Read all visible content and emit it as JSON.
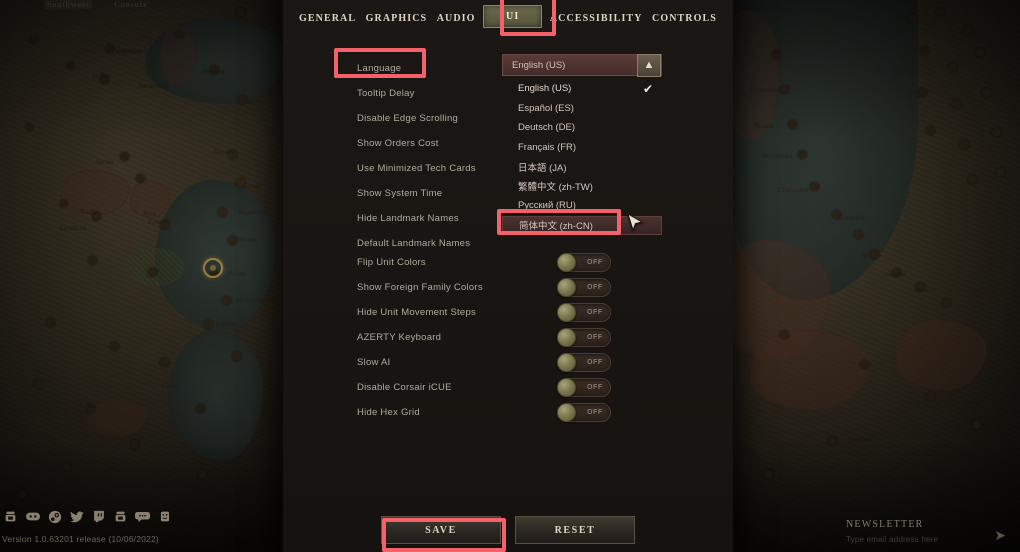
{
  "game": {
    "map_hud": [
      "Southwest",
      "Consuls"
    ],
    "version": "Version 1.0.63201 release (10/06/2022)",
    "social_icons": [
      "gog-icon",
      "discord-icon",
      "steam-icon",
      "twitter-icon",
      "twitch-icon",
      "gog-alt-icon",
      "forum-icon",
      "reddit-icon"
    ],
    "newsletter": {
      "title": "Newsletter",
      "subtitle": "Type email address here",
      "send_icon": "send-icon"
    }
  },
  "settings": {
    "tabs": [
      {
        "label": "General",
        "active": false
      },
      {
        "label": "Graphics",
        "active": false
      },
      {
        "label": "Audio",
        "active": false
      },
      {
        "label": "UI",
        "active": true
      },
      {
        "label": "Accessibility",
        "active": false
      },
      {
        "label": "Controls",
        "active": false
      }
    ],
    "rows": [
      {
        "label": "Language",
        "control": "dropdown"
      },
      {
        "label": "Tooltip Delay",
        "control": "none"
      },
      {
        "label": "Disable Edge Scrolling",
        "control": "none"
      },
      {
        "label": "Show Orders Cost",
        "control": "none"
      },
      {
        "label": "Use Minimized Tech Cards",
        "control": "none"
      },
      {
        "label": "Show System Time",
        "control": "none"
      },
      {
        "label": "Hide Landmark Names",
        "control": "none"
      },
      {
        "label": "Default Landmark Names",
        "control": "none"
      },
      {
        "label": "Flip Unit Colors",
        "control": "toggle",
        "state": "OFF"
      },
      {
        "label": "Show Foreign Family Colors",
        "control": "toggle",
        "state": "OFF"
      },
      {
        "label": "Hide Unit Movement Steps",
        "control": "toggle",
        "state": "OFF"
      },
      {
        "label": "AZERTY Keyboard",
        "control": "toggle",
        "state": "OFF"
      },
      {
        "label": "Slow AI",
        "control": "toggle",
        "state": "OFF"
      },
      {
        "label": "Disable Corsair iCUE",
        "control": "toggle",
        "state": "OFF"
      },
      {
        "label": "Hide Hex Grid",
        "control": "toggle",
        "state": "OFF"
      }
    ],
    "language_dropdown": {
      "selected": "English (US)",
      "expanded": true,
      "collapse_icon": "chevron-up-icon",
      "options": [
        {
          "label": "English (US)",
          "checked": true,
          "highlighted": false
        },
        {
          "label": "Español (ES)",
          "checked": false,
          "highlighted": false
        },
        {
          "label": "Deutsch (DE)",
          "checked": false,
          "highlighted": false
        },
        {
          "label": "Français (FR)",
          "checked": false,
          "highlighted": false
        },
        {
          "label": "日本語 (JA)",
          "checked": false,
          "highlighted": false
        },
        {
          "label": "繁體中文 (zh-TW)",
          "checked": false,
          "highlighted": false
        },
        {
          "label": "Русский (RU)",
          "checked": false,
          "highlighted": false
        },
        {
          "label": "简体中文 (zh-CN)",
          "checked": false,
          "highlighted": true
        }
      ]
    },
    "buttons": {
      "save": "Save",
      "reset": "Reset"
    }
  },
  "annotations": {
    "color": "#f4616a",
    "boxes": [
      "ui-tab-highlight",
      "language-label-highlight",
      "zh-cn-option-highlight",
      "save-button-highlight"
    ]
  }
}
